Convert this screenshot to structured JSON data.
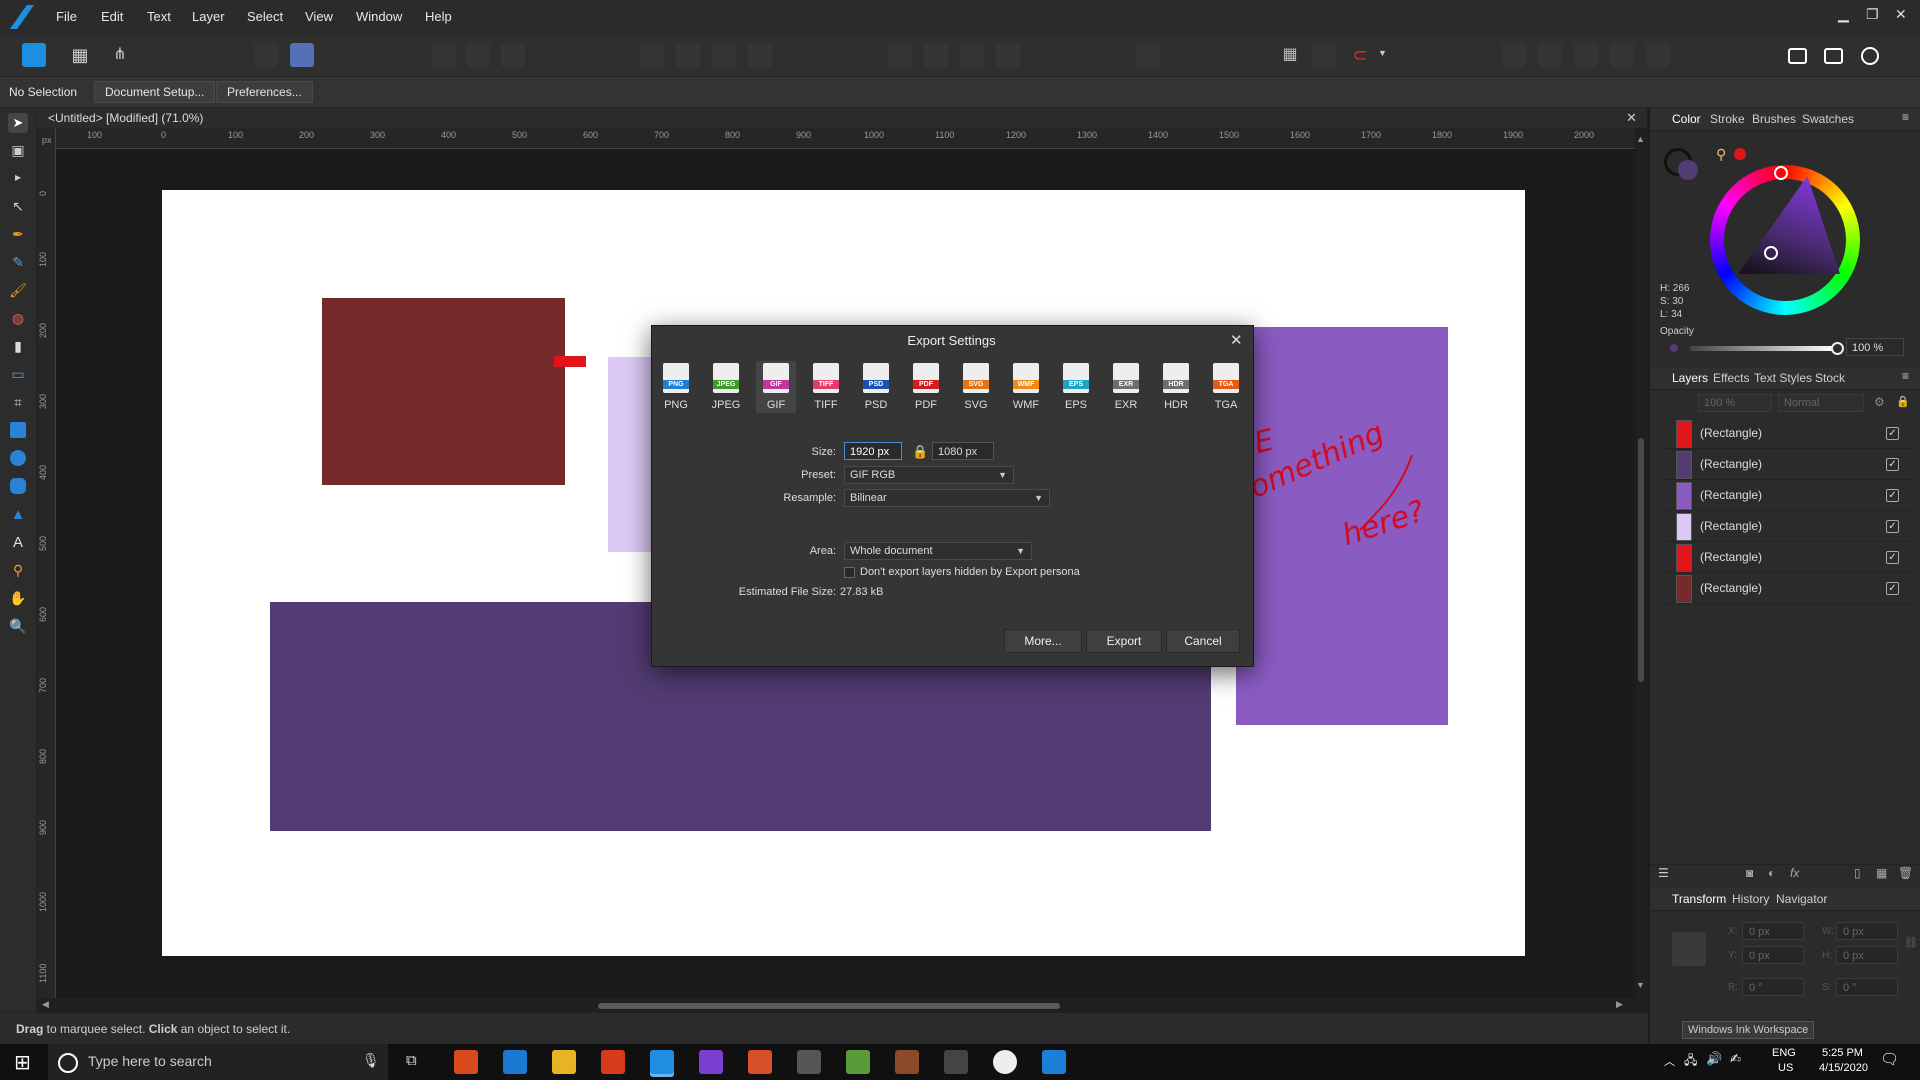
{
  "menu": [
    "File",
    "Edit",
    "Text",
    "Layer",
    "Select",
    "View",
    "Window",
    "Help"
  ],
  "context": {
    "selection": "No Selection",
    "doc_setup": "Document Setup...",
    "preferences": "Preferences..."
  },
  "document": {
    "tab_title": "<Untitled> [Modified] (71.0%)",
    "ruler_unit": "px"
  },
  "ruler_h": [
    "100",
    "0",
    "100",
    "200",
    "300",
    "400",
    "500",
    "600",
    "700",
    "800",
    "900",
    "1000",
    "1100",
    "1200",
    "1300",
    "1400",
    "1500",
    "1600",
    "1700",
    "1800",
    "1900",
    "2000"
  ],
  "ruler_v": [
    "0",
    "100",
    "200",
    "300",
    "400",
    "500",
    "600",
    "700",
    "800",
    "900",
    "1000",
    "1100"
  ],
  "shapes_colors": {
    "dark_red": "#772a2b",
    "lavender": "#dccaf5",
    "dark_purple": "#523c73",
    "medium_purple": "#8a5cc2",
    "red": "#e0151a"
  },
  "status": {
    "bold1": "Drag",
    "text1": " to marquee select. ",
    "bold2": "Click",
    "text2": " an object to select it."
  },
  "panels": {
    "color_tabs": [
      "Color",
      "Stroke",
      "Brushes",
      "Swatches"
    ],
    "hsl": {
      "h": "H: 266",
      "s": "S: 30",
      "l": "L: 34"
    },
    "opacity_label": "Opacity",
    "opacity_value": "100 %",
    "layer_tabs": [
      "Layers",
      "Effects",
      "Text Styles",
      "Stock"
    ],
    "layer_opacity": "100 %",
    "layer_blend": "Normal",
    "layers": [
      {
        "name": "(Rectangle)",
        "color": "#e0151a",
        "checked": "✓"
      },
      {
        "name": "(Rectangle)",
        "color": "#523c73",
        "checked": "✓"
      },
      {
        "name": "(Rectangle)",
        "color": "#8a5cc2",
        "checked": "✓"
      },
      {
        "name": "(Rectangle)",
        "color": "#dccaf5",
        "checked": "✓"
      },
      {
        "name": "(Rectangle)",
        "color": "#e0151a",
        "checked": "✓"
      },
      {
        "name": "(Rectangle)",
        "color": "#772a2b",
        "checked": "✓"
      }
    ],
    "transform_tabs": [
      "Transform",
      "History",
      "Navigator"
    ],
    "transform": {
      "x_label": "X:",
      "y_label": "Y:",
      "w_label": "W:",
      "h_label": "H:",
      "r_label": "R:",
      "s_label": "S:",
      "x": "0 px",
      "y": "0 px",
      "w": "0 px",
      "h": "0 px",
      "r": "0 °",
      "s": "0 °"
    }
  },
  "dialog": {
    "title": "Export Settings",
    "formats": [
      {
        "label": "PNG",
        "color": "#1f7fd1"
      },
      {
        "label": "JPEG",
        "color": "#3f9a2a"
      },
      {
        "label": "GIF",
        "color": "#c0359b"
      },
      {
        "label": "TIFF",
        "color": "#e23c6a"
      },
      {
        "label": "PSD",
        "color": "#1b53b5"
      },
      {
        "label": "PDF",
        "color": "#d11d1d"
      },
      {
        "label": "SVG",
        "color": "#e07416"
      },
      {
        "label": "WMF",
        "color": "#ef8a16"
      },
      {
        "label": "EPS",
        "color": "#1aa6c4"
      },
      {
        "label": "EXR",
        "color": "#6d6d6d"
      },
      {
        "label": "HDR",
        "color": "#6d6d6d"
      },
      {
        "label": "TGA",
        "color": "#e55b14"
      }
    ],
    "size_label": "Size:",
    "width": "1920 px",
    "height": "1080 px",
    "preset_label": "Preset:",
    "preset": "GIF RGB",
    "resample_label": "Resample:",
    "resample": "Bilinear",
    "area_label": "Area:",
    "area": "Whole document",
    "checkbox_label": "Don't export layers hidden by Export persona",
    "file_size_label": "Estimated File Size:",
    "file_size": "27.83 kB",
    "more": "More...",
    "export": "Export",
    "cancel": "Cancel"
  },
  "annotation": {
    "line1": "MAYBE",
    "line2": "something",
    "line3": "here?"
  },
  "taskbar": {
    "search_placeholder": "Type here to search",
    "lang": "ENG",
    "region": "US",
    "time": "5:25 PM",
    "date": "4/15/2020"
  },
  "tooltip": "Windows Ink Workspace"
}
